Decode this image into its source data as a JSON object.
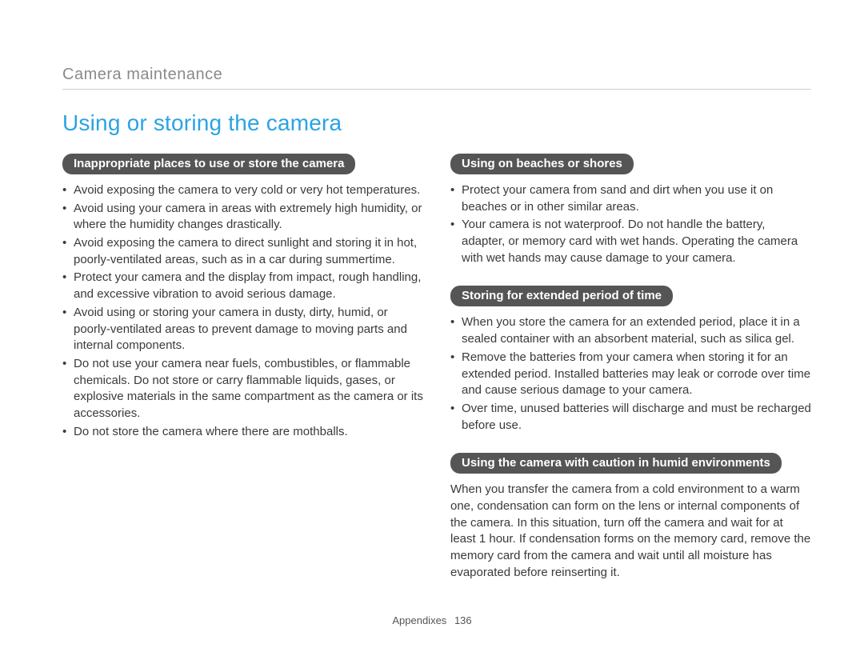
{
  "breadcrumb": "Camera maintenance",
  "title": "Using or storing the camera",
  "left": {
    "s1": {
      "heading": "Inappropriate places to use or store the camera",
      "items": [
        "Avoid exposing the camera to very cold or very hot temperatures.",
        "Avoid using your camera in areas with extremely high humidity, or where the humidity changes drastically.",
        "Avoid exposing the camera to direct sunlight and storing it in hot, poorly-ventilated areas, such as in a car during summertime.",
        "Protect your camera and the display from impact, rough handling, and excessive vibration to avoid serious damage.",
        "Avoid using or storing your camera in dusty, dirty, humid, or poorly-ventilated areas to prevent damage to moving parts and internal components.",
        "Do not use your camera near fuels, combustibles, or flammable chemicals. Do not store or carry flammable liquids, gases, or explosive materials in the same compartment as the camera or its accessories.",
        "Do not store the camera where there are mothballs."
      ]
    }
  },
  "right": {
    "s1": {
      "heading": "Using on beaches or shores",
      "items": [
        "Protect your camera from sand and dirt when you use it on beaches or in other similar areas.",
        "Your camera is not waterproof. Do not handle the battery, adapter, or memory card with wet hands. Operating the camera with wet hands may cause damage to your camera."
      ]
    },
    "s2": {
      "heading": "Storing for extended period of time",
      "items": [
        "When you store the camera for an extended period, place it in a sealed container with an absorbent material, such as silica gel.",
        "Remove the batteries from your camera when storing it for an extended period. Installed batteries may leak or corrode over time and cause serious damage to your camera.",
        "Over time, unused batteries will discharge and must be recharged before use."
      ]
    },
    "s3": {
      "heading": "Using the camera with caution in humid environments",
      "para": "When you transfer the camera from a cold environment to a warm one, condensation can form on the lens or internal components of the camera. In this situation, turn off the camera and wait for at least 1 hour. If condensation forms on the memory card, remove the memory card from the camera and wait until all moisture has evaporated before reinserting it."
    }
  },
  "footer": {
    "label": "Appendixes",
    "page": "136"
  }
}
